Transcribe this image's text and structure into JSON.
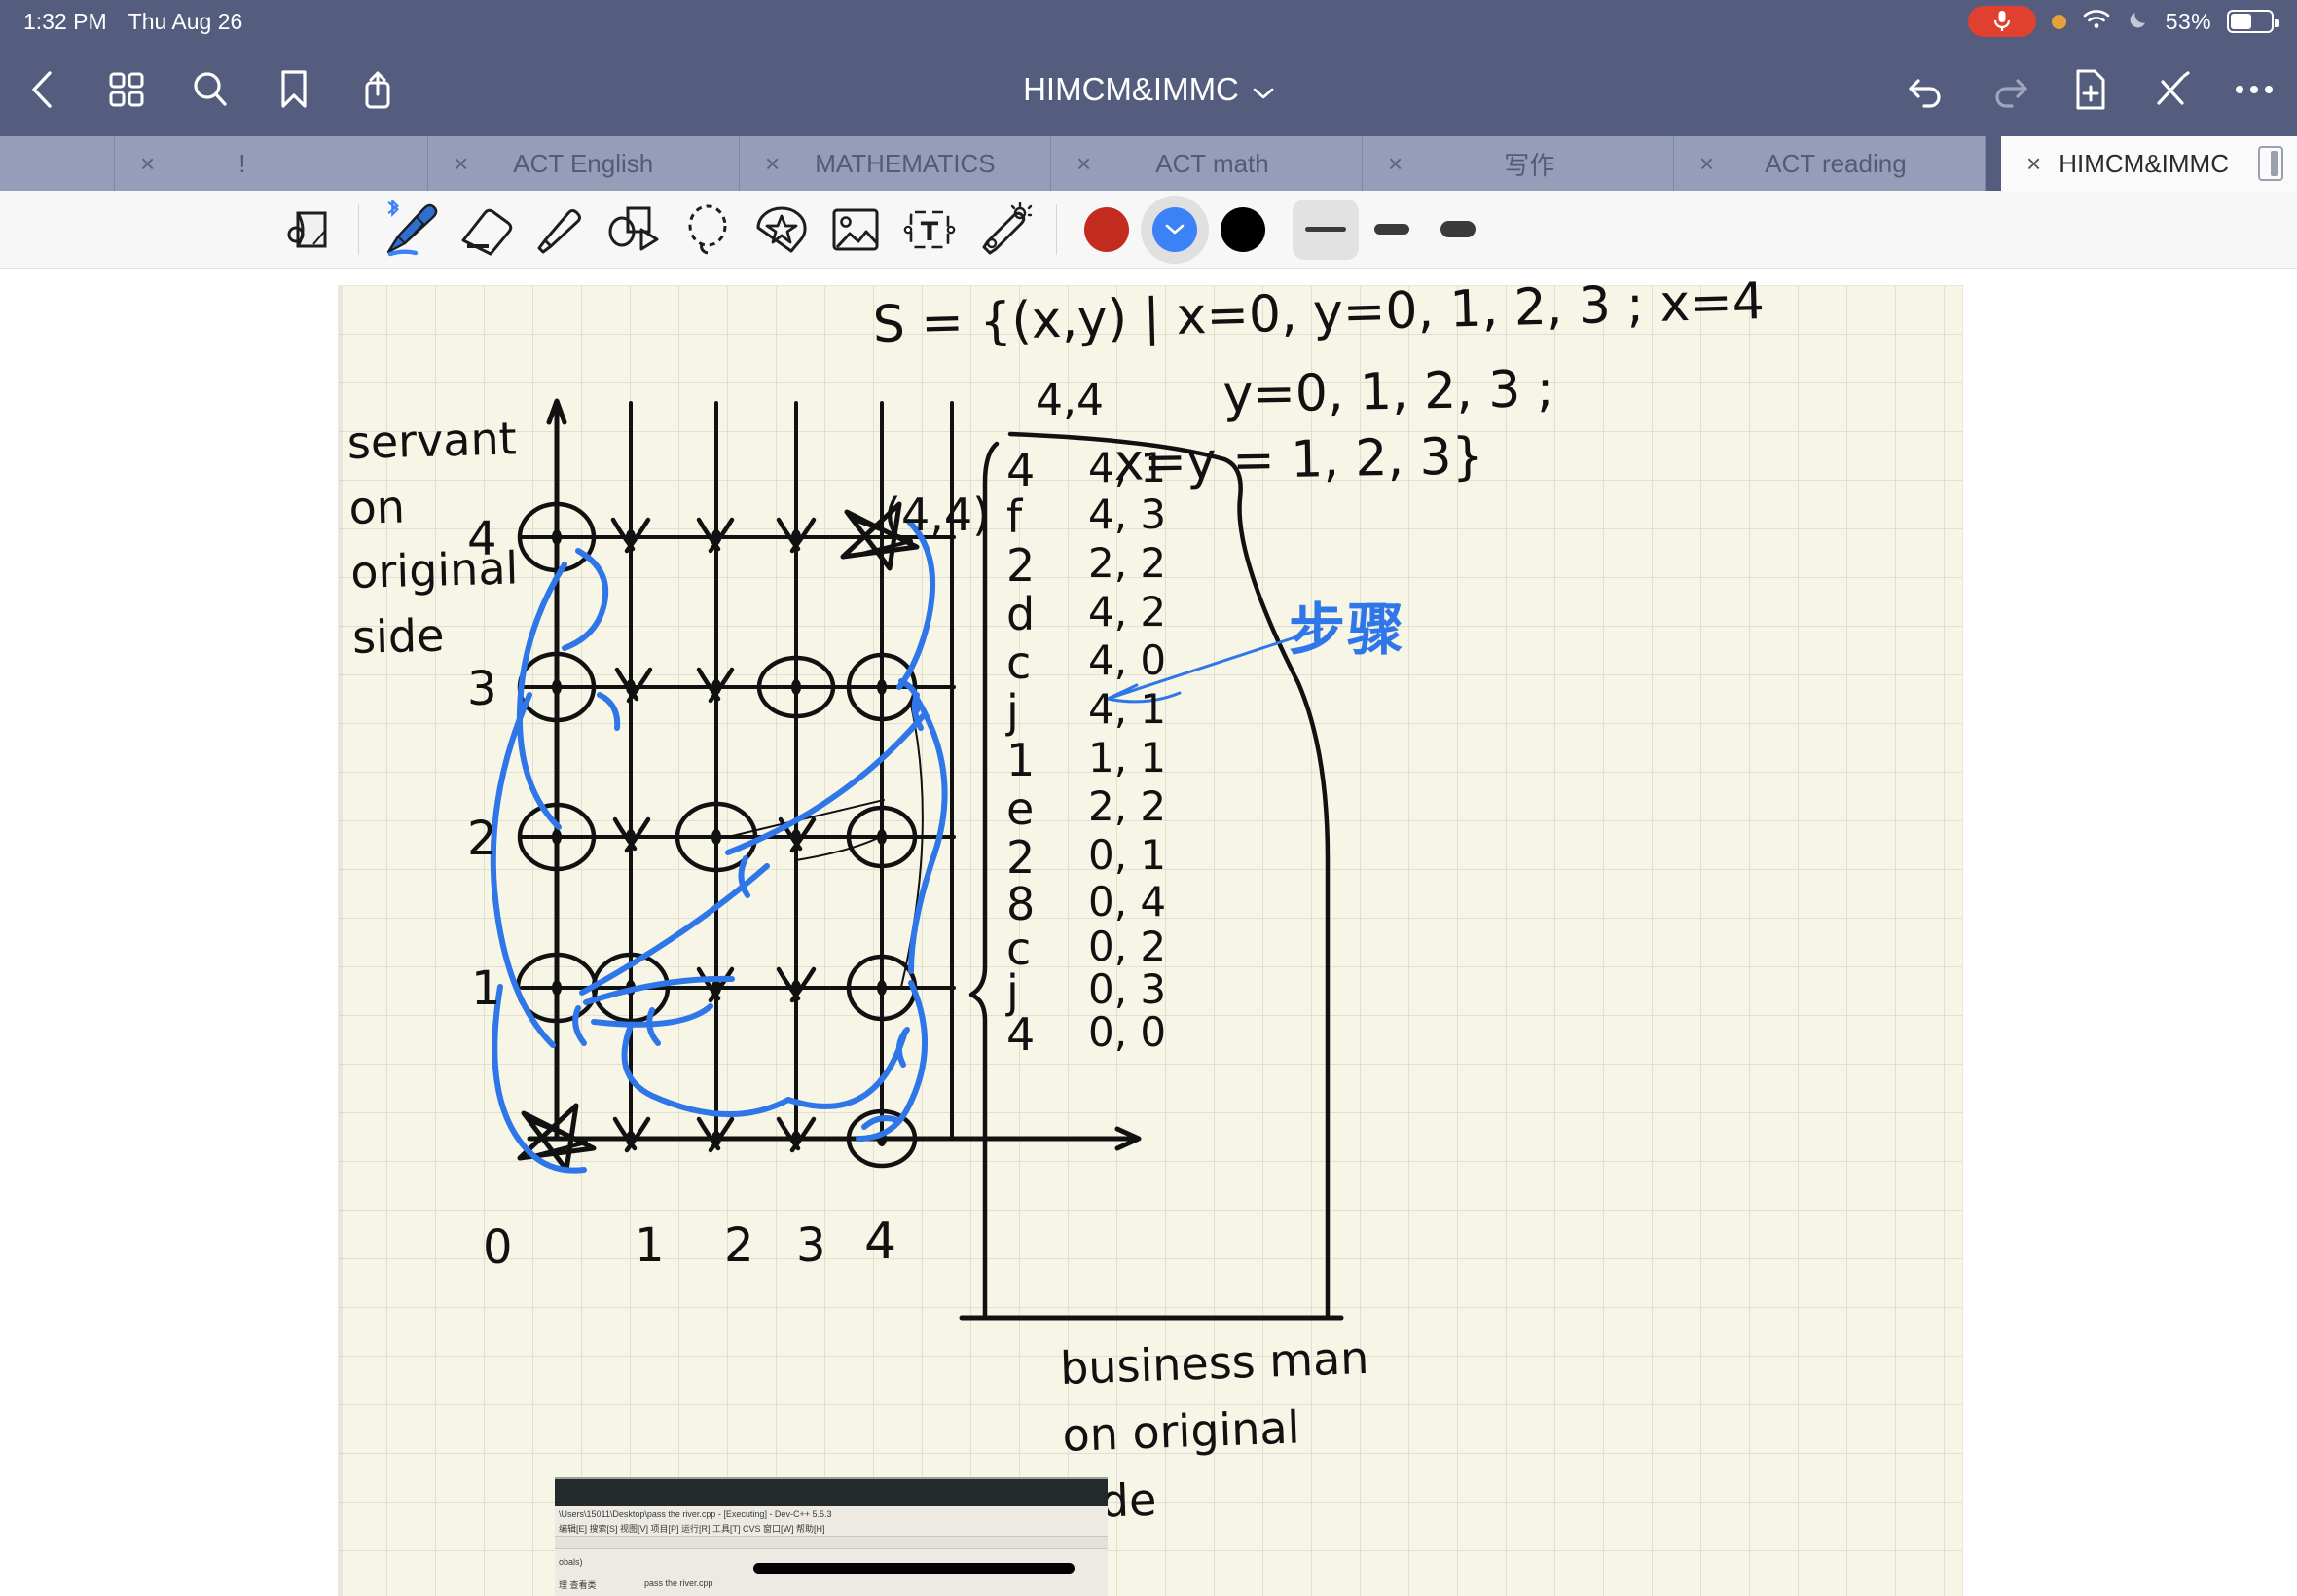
{
  "status_bar": {
    "time": "1:32 PM",
    "date": "Thu Aug 26",
    "mic_icon": "microphone-icon",
    "orange_dot": "recording-indicator",
    "wifi_icon": "wifi-icon",
    "moon_icon": "do-not-disturb-icon",
    "battery_percent": "53%",
    "battery_level": 53
  },
  "nav_bar": {
    "back_icon": "back-chevron-icon",
    "grid_icon": "thumbnails-grid-icon",
    "search_icon": "search-icon",
    "bookmark_icon": "bookmark-icon",
    "share_icon": "share-icon",
    "title": "HIMCM&IMMC",
    "title_chevron": "chevron-down-icon",
    "undo_icon": "undo-icon",
    "redo_icon": "redo-icon",
    "add_page_icon": "add-page-icon",
    "close_tools_icon": "close-pen-icon",
    "more_icon": "more-options-icon"
  },
  "tabs": [
    {
      "label": "",
      "close": "",
      "active": false
    },
    {
      "label": "!",
      "close": "×",
      "active": false
    },
    {
      "label": "ACT English",
      "close": "×",
      "active": false
    },
    {
      "label": "MATHEMATICS",
      "close": "×",
      "active": false
    },
    {
      "label": "ACT math",
      "close": "×",
      "active": false
    },
    {
      "label": "写作",
      "close": "×",
      "active": false
    },
    {
      "label": "ACT reading",
      "close": "×",
      "active": false
    },
    {
      "label": "HIMCM&IMMC",
      "close": "×",
      "active": true
    }
  ],
  "toolbar": {
    "tools": [
      {
        "name": "page-view-icon",
        "selected": false
      },
      {
        "name": "pen-icon",
        "selected": true,
        "bluetooth": true
      },
      {
        "name": "eraser-icon",
        "selected": false
      },
      {
        "name": "highlighter-icon",
        "selected": false
      },
      {
        "name": "shapes-icon",
        "selected": false
      },
      {
        "name": "lasso-select-icon",
        "selected": false
      },
      {
        "name": "sticker-icon",
        "selected": false
      },
      {
        "name": "image-icon",
        "selected": false
      },
      {
        "name": "text-box-icon",
        "selected": false
      },
      {
        "name": "magic-wand-icon",
        "selected": false
      }
    ],
    "colors": [
      {
        "name": "color-red",
        "hex": "#c32b1e",
        "selected": false
      },
      {
        "name": "color-blue",
        "hex": "#3b82f6",
        "selected": true
      },
      {
        "name": "color-black",
        "hex": "#000000",
        "selected": false
      }
    ],
    "widths": [
      {
        "name": "stroke-thin",
        "selected": true
      },
      {
        "name": "stroke-medium",
        "selected": false
      },
      {
        "name": "stroke-thick",
        "selected": false
      }
    ]
  },
  "notes": {
    "set_definition": {
      "line1": "S = {(x,y) | x=0, y=0, 1, 2, 3 ; x=4",
      "line2": "y=0, 1, 2, 3 ;",
      "line3": "x=y = 1, 2, 3}"
    },
    "y_axis_label": "servant on original side",
    "x_axis_label": "business man on original side",
    "point_label": "(4,4)",
    "blue_annotation": "步骤",
    "y_ticks": [
      "4",
      "3",
      "2",
      "1"
    ],
    "x_ticks": [
      "0",
      "1",
      "2",
      "3",
      "4"
    ],
    "move_list_header": "4,4",
    "move_list": [
      {
        "key": "4",
        "coord": "4, 1"
      },
      {
        "key": "f",
        "coord": "4, 3"
      },
      {
        "key": "2",
        "coord": "2, 2"
      },
      {
        "key": "d",
        "coord": "4, 2"
      },
      {
        "key": "c",
        "coord": "4, 0"
      },
      {
        "key": "j",
        "coord": "4, 1"
      },
      {
        "key": "1",
        "coord": "1, 1"
      },
      {
        "key": "e",
        "coord": "2, 2"
      },
      {
        "key": "2",
        "coord": "0, 1"
      },
      {
        "key": "8",
        "coord": "0, 4"
      },
      {
        "key": "c",
        "coord": "0, 2"
      },
      {
        "key": "j",
        "coord": "0, 3"
      },
      {
        "key": "4",
        "coord": "0, 0"
      }
    ]
  },
  "photo": {
    "title_bar": "\\Users\\15011\\Desktop\\pass the river.cpp - [Executing] - Dev-C++ 5.5.3",
    "menu": "编辑[E]   搜索[S]   视图[V]   项目[P]   运行[R]   工具[T]   CVS   窗口[W]   帮助[H]",
    "globals": "obals)",
    "status": "理   查看类",
    "filename": "pass the river.cpp"
  }
}
